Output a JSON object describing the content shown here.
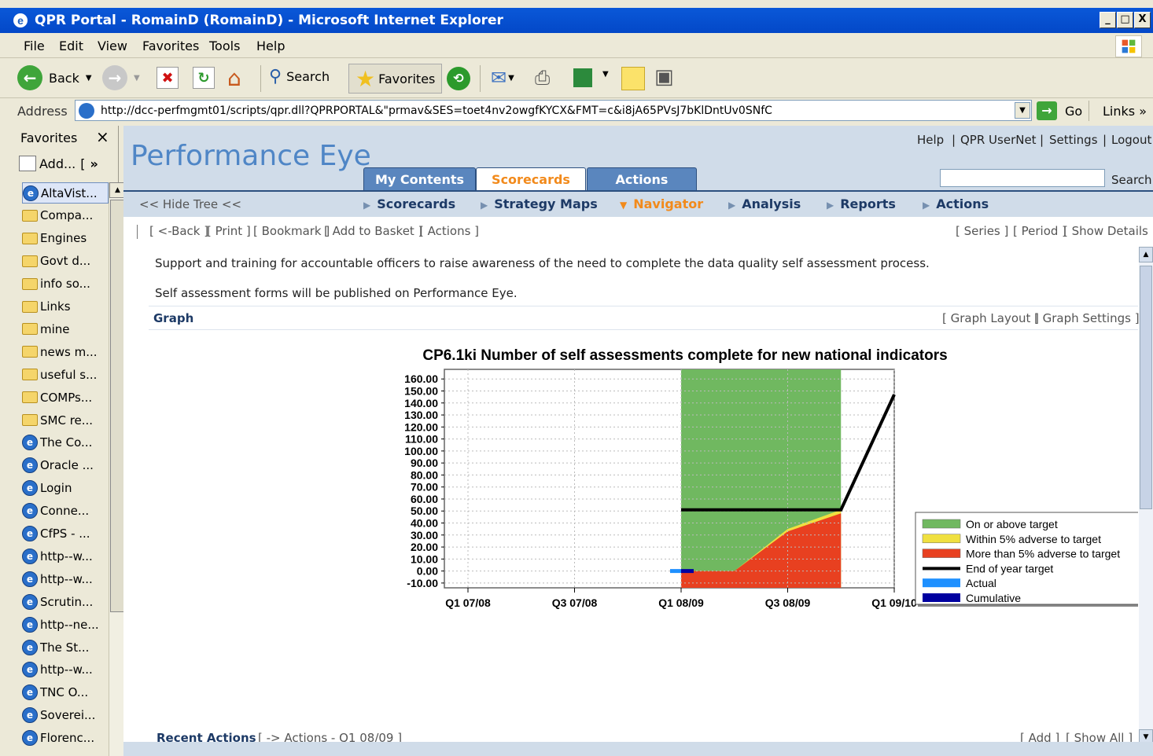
{
  "window": {
    "title": "QPR Portal - RomainD (RomainD) - Microsoft Internet Explorer",
    "btn_min": "_",
    "btn_max": "□",
    "btn_close": "X"
  },
  "menu": [
    "File",
    "Edit",
    "View",
    "Favorites",
    "Tools",
    "Help"
  ],
  "toolbar": {
    "back": "Back",
    "search": "Search",
    "favorites": "Favorites"
  },
  "address": {
    "label": "Address",
    "url": "http://dcc-perfmgmt01/scripts/qpr.dll?QPRPORTAL&\"prmav&SES=toet4nv2owgfKYCX&FMT=c&i8jA65PVsJ7bKlDntUv0SNfC",
    "go": "Go",
    "links": "Links"
  },
  "favorites": {
    "title": "Favorites",
    "close": "×",
    "add": "Add...",
    "organize": "[",
    "more": "»",
    "items": [
      {
        "type": "page",
        "label": "AltaVist..."
      },
      {
        "type": "folder",
        "label": "Compa..."
      },
      {
        "type": "folder",
        "label": "Engines"
      },
      {
        "type": "folder",
        "label": "Govt d..."
      },
      {
        "type": "folder",
        "label": "info so..."
      },
      {
        "type": "folder",
        "label": "Links"
      },
      {
        "type": "folder",
        "label": "mine"
      },
      {
        "type": "folder",
        "label": "news m..."
      },
      {
        "type": "folder",
        "label": "useful s..."
      },
      {
        "type": "folder",
        "label": "COMPs..."
      },
      {
        "type": "folder",
        "label": "SMC re..."
      },
      {
        "type": "page",
        "label": "The Co..."
      },
      {
        "type": "page",
        "label": "Oracle ..."
      },
      {
        "type": "page",
        "label": "Login"
      },
      {
        "type": "page",
        "label": "Conne..."
      },
      {
        "type": "page",
        "label": "CfPS - ..."
      },
      {
        "type": "page",
        "label": "http--w..."
      },
      {
        "type": "page",
        "label": "http--w..."
      },
      {
        "type": "page",
        "label": "Scrutin..."
      },
      {
        "type": "page",
        "label": "http--ne..."
      },
      {
        "type": "page",
        "label": "The St..."
      },
      {
        "type": "page",
        "label": "http--w..."
      },
      {
        "type": "page",
        "label": "TNC O..."
      },
      {
        "type": "page",
        "label": "Soverei..."
      },
      {
        "type": "page",
        "label": "Florenc..."
      }
    ]
  },
  "portal": {
    "logo": "Performance Eye",
    "top_links": {
      "help": "Help",
      "usernet": "QPR UserNet",
      "settings": "Settings",
      "logout": "Logout",
      "sep": "|"
    },
    "tabs": {
      "my_contents": "My Contents",
      "scorecards": "Scorecards",
      "actions": "Actions"
    },
    "search_label": "Search",
    "hide_tree": "<< Hide Tree <<",
    "subnav": {
      "scorecards": "Scorecards",
      "strategy_maps": "Strategy Maps",
      "navigator": "Navigator",
      "analysis": "Analysis",
      "reports": "Reports",
      "actions": "Actions"
    },
    "action_links": {
      "back": "[ <-Back ]",
      "print": "[ Print ]",
      "bookmark": "[ Bookmark ]",
      "add_basket": "[ Add to Basket ]",
      "actions": "[ Actions ]"
    },
    "right_links": {
      "series": "[ Series ]",
      "period": "[ Period ]",
      "details": "[ Show Details ]"
    },
    "description_1": "Support and training for accountable officers to raise awareness of the need to complete the data quality self assessment process.",
    "description_2": "Self assessment forms will be published on Performance Eye.",
    "graph_label": "Graph",
    "graph_links": {
      "layout": "[ Graph Layout ]",
      "settings": "[ Graph Settings ]"
    },
    "recent": {
      "label": "Recent Actions",
      "link": "[ -> Actions - Q1 08/09 ]",
      "add": "[ Add ]",
      "show_all": "[ Show All ]"
    }
  },
  "chart_data": {
    "type": "area",
    "title": "CP6.1ki Number of self assessments complete for new national indicators",
    "x_ticks": [
      "Q1 07/08",
      "Q3 07/08",
      "Q1 08/09",
      "Q3 08/09",
      "Q1 09/10"
    ],
    "y_ticks": [
      "160.00",
      "150.00",
      "140.00",
      "130.00",
      "120.00",
      "110.00",
      "100.00",
      "90.00",
      "80.00",
      "70.00",
      "60.00",
      "50.00",
      "40.00",
      "30.00",
      "20.00",
      "10.00",
      "0.00",
      "-10.00"
    ],
    "ylim": [
      -14,
      168
    ],
    "x_periods": [
      "Q1 07/08",
      "Q2 07/08",
      "Q3 07/08",
      "Q4 07/08",
      "Q1 08/09",
      "Q2 08/09",
      "Q3 08/09",
      "Q4 08/09",
      "Q1 09/10"
    ],
    "band_range": [
      "Q1 08/09",
      "Q4 08/09"
    ],
    "bands": {
      "more_than_5pct_adverse_upper": [
        {
          "x": "Q1 08/09",
          "y": 0
        },
        {
          "x": "Q2 08/09",
          "y": 0
        },
        {
          "x": "Q3 08/09",
          "y": 33
        },
        {
          "x": "Q4 08/09",
          "y": 48
        }
      ],
      "within_5pct_adverse_upper": [
        {
          "x": "Q1 08/09",
          "y": 0
        },
        {
          "x": "Q2 08/09",
          "y": 0
        },
        {
          "x": "Q3 08/09",
          "y": 35
        },
        {
          "x": "Q4 08/09",
          "y": 51
        }
      ],
      "on_or_above_target_upper": 168
    },
    "series": [
      {
        "name": "End of year target",
        "color": "#000000",
        "points": [
          {
            "x": "Q1 08/09",
            "y": 51
          },
          {
            "x": "Q4 08/09",
            "y": 51
          },
          {
            "x": "Q1 09/10",
            "y": 147
          }
        ]
      },
      {
        "name": "Actual",
        "color": "#1e90ff",
        "points": [
          {
            "x": "Q1 08/09",
            "y": 0
          }
        ]
      },
      {
        "name": "Cumulative",
        "color": "#0000a0",
        "points": [
          {
            "x": "Q1 08/09",
            "y": 0
          }
        ]
      }
    ],
    "legend": [
      {
        "label": "On or above target",
        "color": "#70b860"
      },
      {
        "label": "Within 5% adverse to target",
        "color": "#f0e040"
      },
      {
        "label": "More than 5% adverse to target",
        "color": "#e84020"
      },
      {
        "label": "End of year target",
        "color": "#000000"
      },
      {
        "label": "Actual",
        "color": "#1e90ff"
      },
      {
        "label": "Cumulative",
        "color": "#0000a0"
      }
    ],
    "legend_position": "right",
    "grid": true
  }
}
